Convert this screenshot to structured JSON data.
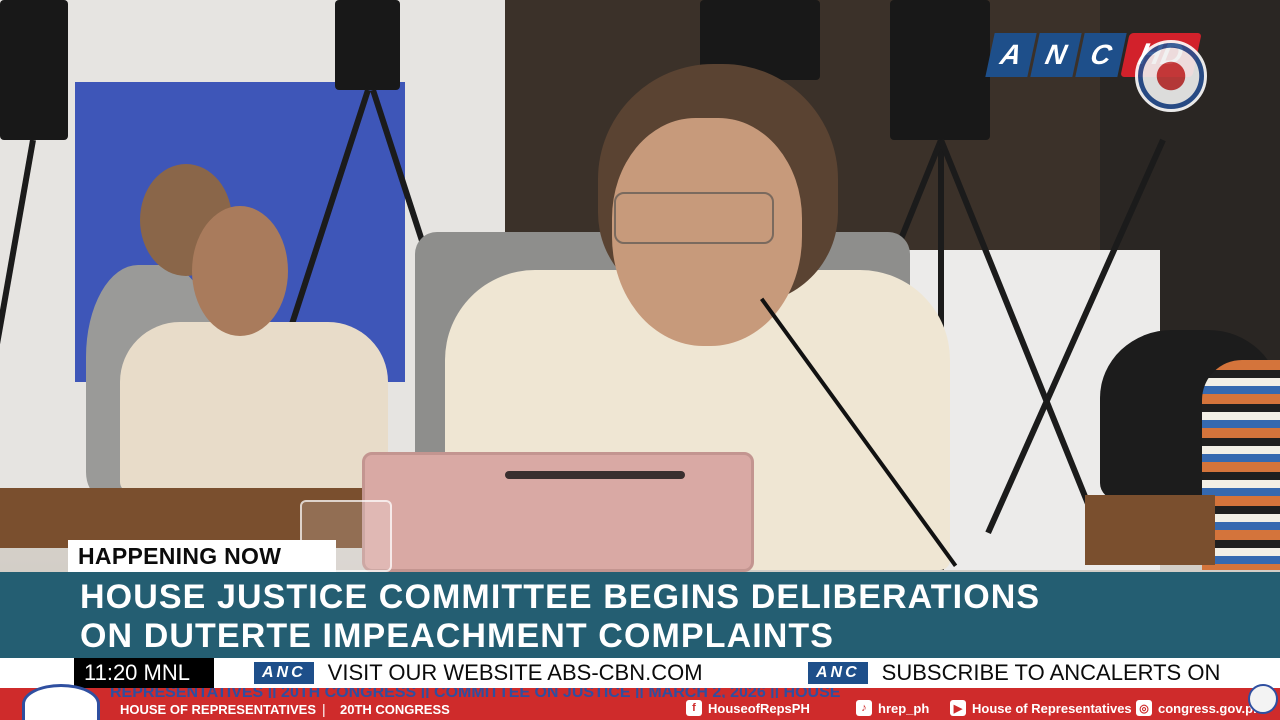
{
  "broadcast": {
    "logo_letters": [
      "A",
      "N",
      "C"
    ],
    "logo_hd": "HD",
    "tag": "HAPPENING NOW",
    "headline_line1": "HOUSE JUSTICE COMMITTEE BEGINS DELIBERATIONS",
    "headline_line2": "ON DUTERTE IMPEACHMENT COMPLAINTS"
  },
  "ticker": {
    "time": "11:20 MNL",
    "logo": "ANC",
    "item1": "VISIT OUR WEBSITE ABS-CBN.COM",
    "item2": "SUBSCRIBE TO ANCALERTS ON"
  },
  "house_bar": {
    "scroll_text": "REPRESENTATIVES  ||  20TH CONGRESS  ||  COMMITTEE ON JUSTICE  ||  MARCH 2, 2026  ||  HOUSE",
    "left_label": "HOUSE OF REPRESENTATIVES",
    "separator": "|",
    "congress": "20TH CONGRESS",
    "socials": [
      {
        "icon": "facebook-x-icon",
        "glyph": "f",
        "label": "HouseofRepsPH"
      },
      {
        "icon": "tiktok-icon",
        "glyph": "♪",
        "label": "hrep_ph"
      },
      {
        "icon": "youtube-icon",
        "glyph": "▶",
        "label": "House of Representatives"
      },
      {
        "icon": "globe-icon",
        "glyph": "◎",
        "label": "congress.gov.ph"
      }
    ]
  },
  "colors": {
    "headline_bar": "#245e72",
    "anc_blue": "#1e4f8a",
    "hd_red": "#d2212b",
    "house_red": "#cf2b2b"
  }
}
